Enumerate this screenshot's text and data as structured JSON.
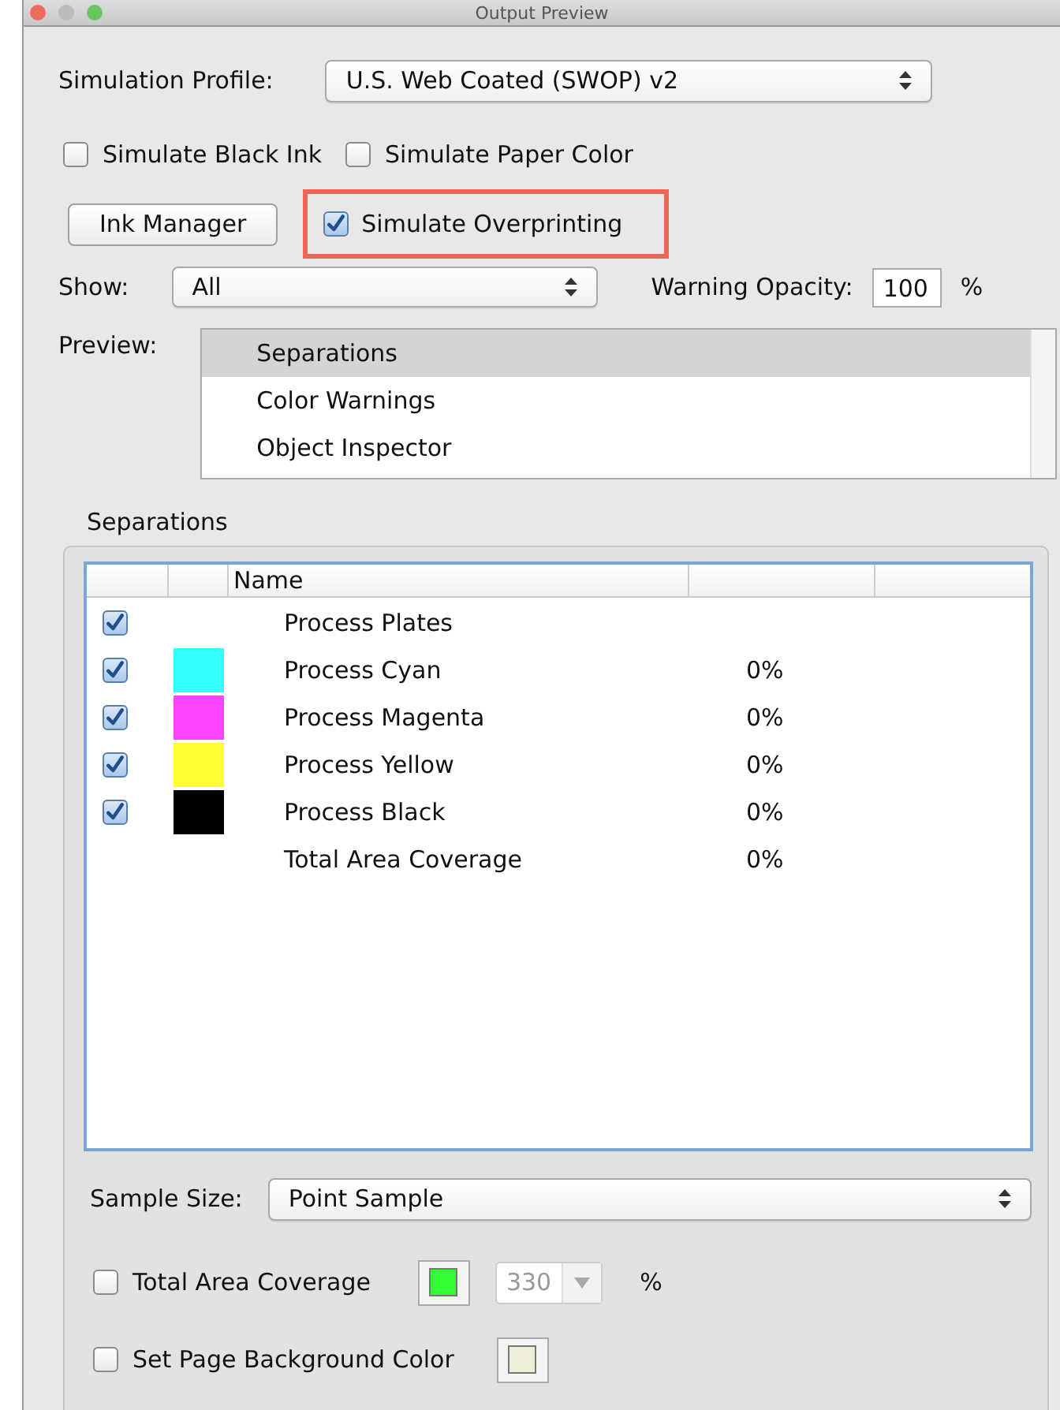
{
  "window": {
    "title": "Output Preview"
  },
  "simulation_profile": {
    "label": "Simulation Profile:",
    "value": "U.S. Web Coated (SWOP) v2"
  },
  "options": [
    {
      "label": "Simulate Black Ink",
      "checked": false
    },
    {
      "label": "Simulate Paper Color",
      "checked": false
    }
  ],
  "ink_manager_button": "Ink Manager",
  "simulate_overprinting": {
    "label": "Simulate Overprinting",
    "checked": true,
    "highlighted": true
  },
  "show": {
    "label": "Show:",
    "value": "All"
  },
  "warning_opacity": {
    "label": "Warning Opacity:",
    "value": "100",
    "unit": "%"
  },
  "preview": {
    "label": "Preview:",
    "items": [
      {
        "label": "Separations",
        "selected": true
      },
      {
        "label": "Color Warnings",
        "selected": false
      },
      {
        "label": "Object Inspector",
        "selected": false
      }
    ]
  },
  "separations": {
    "title": "Separations",
    "columns": [
      "Name"
    ],
    "rows": [
      {
        "kind": "plates",
        "name": "Process Plates",
        "checked": true
      },
      {
        "kind": "ink",
        "name": "Process Cyan",
        "checked": true,
        "color": "#33ffff",
        "coverage": "0%"
      },
      {
        "kind": "ink",
        "name": "Process Magenta",
        "checked": true,
        "color": "#ff44ff",
        "coverage": "0%"
      },
      {
        "kind": "ink",
        "name": "Process Yellow",
        "checked": true,
        "color": "#ffff33",
        "coverage": "0%"
      },
      {
        "kind": "ink",
        "name": "Process Black",
        "checked": true,
        "color": "#000000",
        "coverage": "0%"
      },
      {
        "kind": "total",
        "name": "Total Area Coverage",
        "coverage": "0%"
      }
    ]
  },
  "sample_size": {
    "label": "Sample Size:",
    "value": "Point Sample"
  },
  "total_area_coverage": {
    "label": "Total Area Coverage",
    "checked": false,
    "color": "#33ff33",
    "value": "330",
    "disabled": true,
    "unit": "%"
  },
  "page_background": {
    "label": "Set Page Background Color",
    "checked": false,
    "color": "#eeeed8"
  }
}
